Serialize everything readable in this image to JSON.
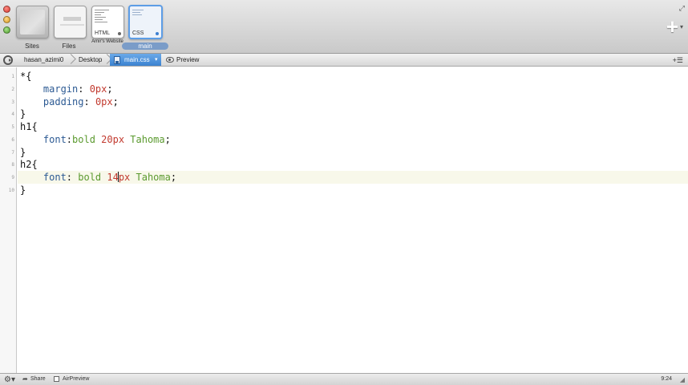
{
  "toolbar": {
    "sites_label": "Sites",
    "files_label": "Files",
    "website_label": "Amir's Website",
    "website_tag": "HTML",
    "main_label": "main",
    "main_tag": "CSS",
    "add_icon": "plus-icon",
    "fullscreen_icon": "fullscreen-arrows-icon"
  },
  "pathbar": {
    "crumbs": [
      "hasan_azimi0",
      "Desktop"
    ],
    "file": "main.css",
    "preview_label": "Preview"
  },
  "editor": {
    "line_numbers": [
      "1",
      "2",
      "3",
      "4",
      "5",
      "6",
      "7",
      "8",
      "9",
      "10"
    ],
    "lines": [
      [
        {
          "t": "*{",
          "c": "sel"
        }
      ],
      [
        {
          "t": "    margin",
          "c": "prop"
        },
        {
          "t": ": ",
          "c": "punc"
        },
        {
          "t": "0px",
          "c": "num"
        },
        {
          "t": ";",
          "c": "punc"
        }
      ],
      [
        {
          "t": "    padding",
          "c": "prop"
        },
        {
          "t": ": ",
          "c": "punc"
        },
        {
          "t": "0px",
          "c": "num"
        },
        {
          "t": ";",
          "c": "punc"
        }
      ],
      [
        {
          "t": "}",
          "c": "sel"
        }
      ],
      [
        {
          "t": "h1{",
          "c": "sel"
        }
      ],
      [
        {
          "t": "    font",
          "c": "prop"
        },
        {
          "t": ":",
          "c": "punc"
        },
        {
          "t": "bold ",
          "c": "val"
        },
        {
          "t": "20px",
          "c": "num"
        },
        {
          "t": " Tahoma",
          "c": "val"
        },
        {
          "t": ";",
          "c": "punc"
        }
      ],
      [
        {
          "t": "}",
          "c": "sel"
        }
      ],
      [
        {
          "t": "h2{",
          "c": "sel"
        }
      ],
      [
        {
          "t": "    font",
          "c": "prop"
        },
        {
          "t": ": ",
          "c": "punc"
        },
        {
          "t": "bold ",
          "c": "val"
        },
        {
          "t": "14",
          "c": "num",
          "caret": true
        },
        {
          "t": "px",
          "c": "num"
        },
        {
          "t": " Tahoma",
          "c": "val"
        },
        {
          "t": ";",
          "c": "punc"
        }
      ],
      [
        {
          "t": "}",
          "c": "sel"
        }
      ]
    ],
    "current_line": 9
  },
  "statusbar": {
    "share_label": "Share",
    "airpreview_label": "AirPreview",
    "cursor_position": "9:24"
  }
}
